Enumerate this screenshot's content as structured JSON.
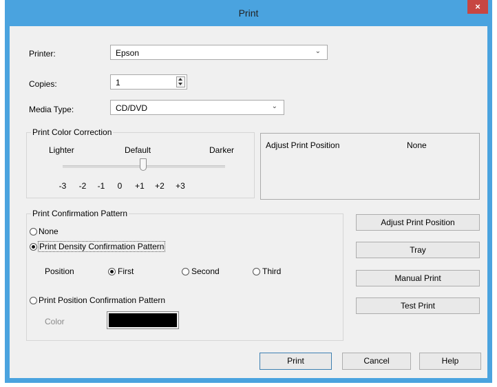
{
  "window": {
    "title": "Print",
    "close_glyph": "×"
  },
  "printer": {
    "label": "Printer:",
    "value": "Epson"
  },
  "copies": {
    "label": "Copies:",
    "value": "1"
  },
  "media_type": {
    "label": "Media Type:",
    "value": "CD/DVD"
  },
  "color_correction": {
    "title": "Print Color Correction",
    "lighter": "Lighter",
    "default": "Default",
    "darker": "Darker",
    "ticks": [
      "-3",
      "-2",
      "-1",
      "0",
      "+1",
      "+2",
      "+3"
    ],
    "selected": "0"
  },
  "adjust_position_info": {
    "label": "Adjust Print Position",
    "value": "None"
  },
  "confirmation": {
    "title": "Print Confirmation Pattern",
    "none": "None",
    "density": "Print Density Confirmation Pattern",
    "position_label": "Position",
    "first": "First",
    "second": "Second",
    "third": "Third",
    "position_pattern": "Print Position Confirmation Pattern",
    "color_label": "Color",
    "color_value": "#000000"
  },
  "side_buttons": {
    "adjust": "Adjust Print Position",
    "tray": "Tray",
    "manual": "Manual Print",
    "test": "Test Print"
  },
  "footer": {
    "print": "Print",
    "cancel": "Cancel",
    "help": "Help"
  }
}
